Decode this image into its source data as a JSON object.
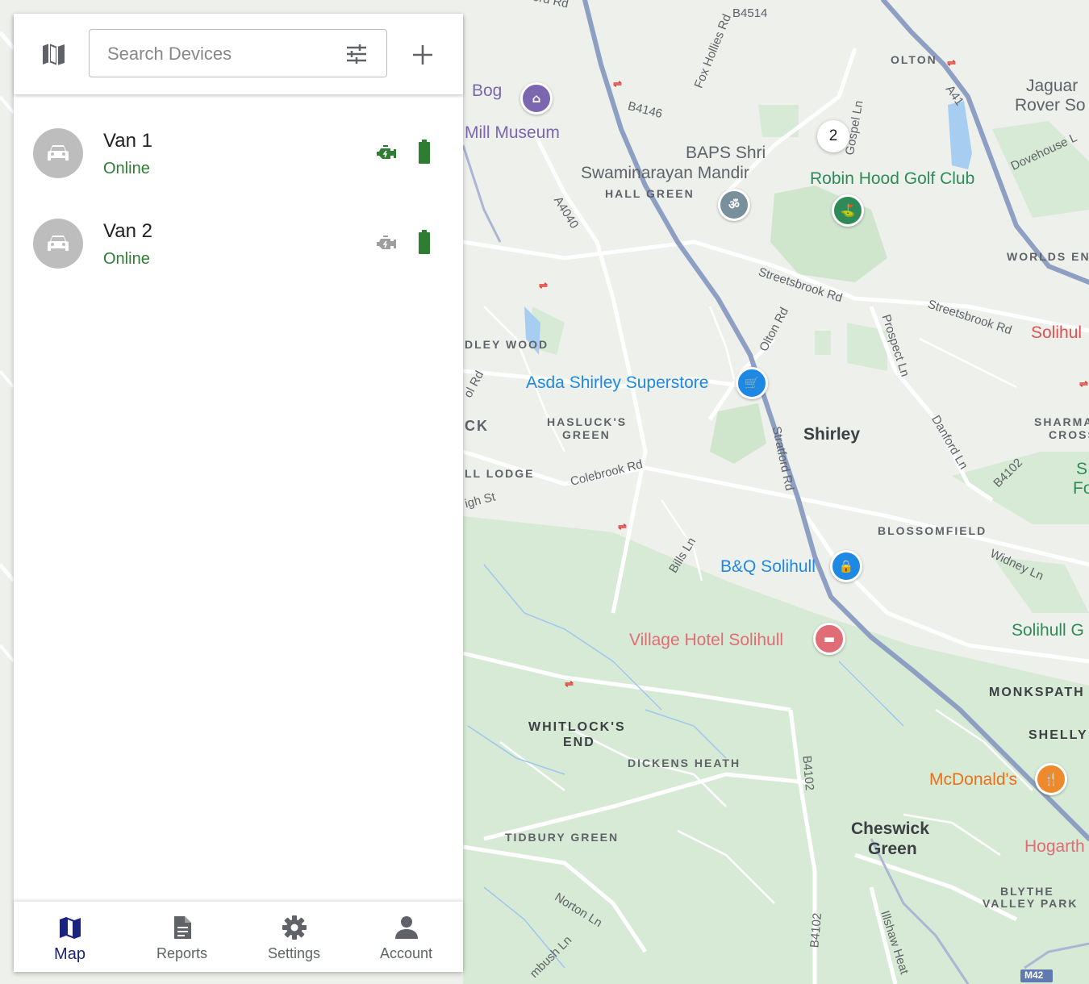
{
  "search": {
    "placeholder": "Search Devices"
  },
  "devices": [
    {
      "name": "Van 1",
      "status": "Online",
      "engine_on": true,
      "battery_color": "#2e7d32"
    },
    {
      "name": "Van 2",
      "status": "Online",
      "engine_on": false,
      "battery_color": "#2e7d32"
    }
  ],
  "nav": {
    "active": "Map",
    "items": [
      {
        "label": "Map",
        "icon": "map-icon"
      },
      {
        "label": "Reports",
        "icon": "document-icon"
      },
      {
        "label": "Settings",
        "icon": "gear-icon"
      },
      {
        "label": "Account",
        "icon": "person-icon"
      }
    ]
  },
  "colors": {
    "accent": "#1a237e",
    "online": "#2e7d32",
    "engine_on": "#2e7d32",
    "engine_off": "#9e9e9e"
  },
  "map": {
    "cluster_count": "2",
    "roads": {
      "b4514": "B4514",
      "fox_hollies": "Fox Hollies Rd",
      "b4146": "B4146",
      "a4040": "A4040",
      "a41": "A41",
      "gospel": "Gospel Ln",
      "dovehouse": "Dovehouse L",
      "streetsbrook1": "Streetsbrook Rd",
      "streetsbrook2": "Streetsbrook Rd",
      "olton": "Olton Rd",
      "prospect": "Prospect Ln",
      "stratford": "Stratford Rd",
      "danford": "Danford Ln",
      "b4102a": "B4102",
      "colebrook": "Colebrook Rd",
      "high_st": "igh St",
      "wol": "ol Rd",
      "bills": "Bills Ln",
      "widney": "Widney Ln",
      "b4102b": "B4102",
      "b4102c": "B4102",
      "norton": "Norton Ln",
      "tanworth": "mbush Ln",
      "illshaw": "Illshaw Heat",
      "m42": "M42",
      "top_rd": "ord Rd"
    },
    "places": {
      "olton": "OLTON",
      "hall_green": "HALL GREEN",
      "worlds_end": "WORLDS ENI",
      "idley_wood": "DLEY WOOD",
      "hasluck1": "HASLUCK'S",
      "hasluck2": "GREEN",
      "ck": "CK",
      "ll_lodge": "LL LODGE",
      "blossomfield": "BLOSSOMFIELD",
      "sharma1": "SHARMA",
      "sharma2": "CROSS",
      "monkspath": "MONKSPATH",
      "shelly": "SHELLY",
      "whitlocks1": "WHITLOCK'S",
      "whitlocks2": "END",
      "dickens": "DICKENS HEATH",
      "tidbury": "TIDBURY GREEN",
      "blythe1": "BLYTHE",
      "blythe2": "VALLEY PARK"
    },
    "towns": {
      "shirley": "Shirley",
      "cheswick1": "Cheswick",
      "cheswick2": "Green"
    },
    "pois": {
      "bog": "Bog",
      "mill_museum": "Mill Museum",
      "baps1": "BAPS Shri",
      "baps2": "Swaminarayan Mandir",
      "robin_hood": "Robin Hood Golf Club",
      "jaguar1": "Jaguar",
      "jaguar2": "Rover So",
      "asda": "Asda Shirley Superstore",
      "bq": "B&Q Solihull",
      "village": "Village Hotel Solihull",
      "mcdonalds": "McDonald's",
      "solihull": "Solihul",
      "solihull_g": "Solihull G",
      "hogarth": "Hogarth",
      "sf": "S",
      "fo": "Fo"
    }
  }
}
